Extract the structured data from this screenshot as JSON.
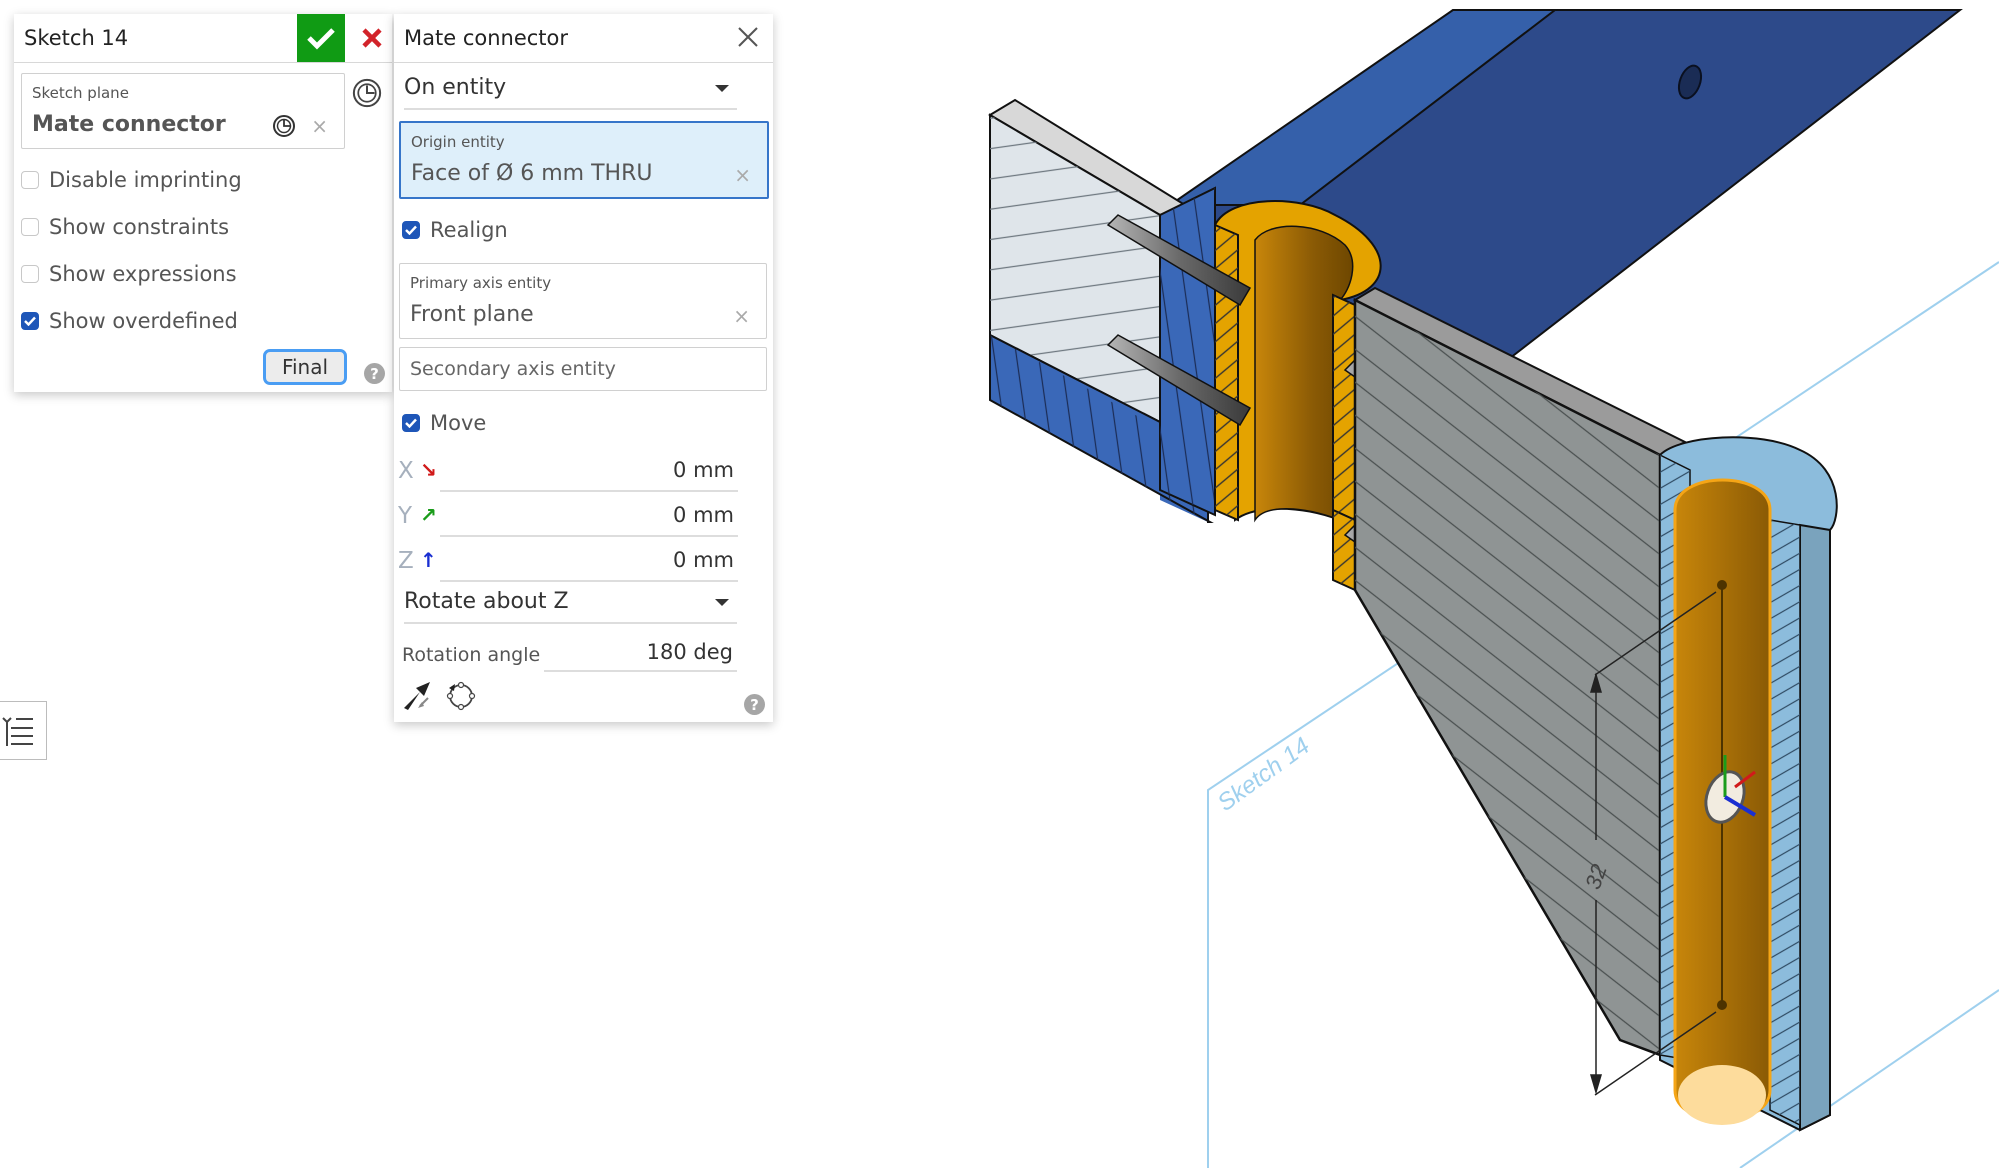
{
  "sketch_panel": {
    "title": "Sketch 14",
    "confirm_icon": "check-icon",
    "cancel_icon": "close-x-icon",
    "sketch_plane": {
      "label": "Sketch plane",
      "value": "Mate connector"
    },
    "options": [
      {
        "label": "Disable imprinting",
        "checked": false
      },
      {
        "label": "Show constraints",
        "checked": false
      },
      {
        "label": "Show expressions",
        "checked": false
      },
      {
        "label": "Show overdefined",
        "checked": true
      }
    ],
    "final_button": "Final",
    "help": "?"
  },
  "mate_connector_panel": {
    "title": "Mate connector",
    "placement_type": "On entity",
    "origin_entity": {
      "label": "Origin entity",
      "value": "Face of Ø 6 mm THRU"
    },
    "realign": {
      "label": "Realign",
      "checked": true
    },
    "primary_axis_entity": {
      "label": "Primary axis entity",
      "value": "Front plane"
    },
    "secondary_axis_entity": {
      "placeholder": "Secondary axis entity"
    },
    "move": {
      "label": "Move",
      "checked": true
    },
    "offsets": [
      {
        "axis": "X",
        "arrow": "↘",
        "color": "#d11a1a",
        "value": "0 mm"
      },
      {
        "axis": "Y",
        "arrow": "↗",
        "color": "#1a9c1a",
        "value": "0 mm"
      },
      {
        "axis": "Z",
        "arrow": "↑",
        "color": "#1a2fd1",
        "value": "0 mm"
      }
    ],
    "rotation_type": "Rotate about Z",
    "rotation_angle": {
      "label": "Rotation angle",
      "value": "180 deg"
    },
    "help": "?"
  },
  "viewport": {
    "sketch_label": "Sketch 14",
    "dimension_value": "32",
    "colors": {
      "blue_part": "#2d4a8a",
      "blue_part_light": "#3560aa",
      "gold_part": "#e4a300",
      "gray_part": "#8f9494",
      "light_blue_part": "#8cbcdc",
      "sketch_plane_line": "#9fd0ee"
    }
  },
  "side_toolbar": {
    "list_icon": "feature-list-icon"
  }
}
